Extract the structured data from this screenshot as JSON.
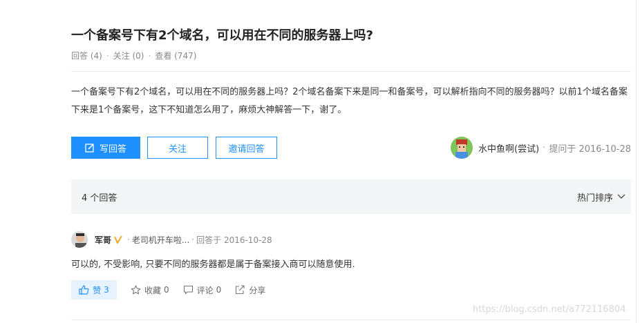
{
  "question": {
    "title": "一个备案号下有2个域名，可以用在不同的服务器上吗?",
    "answers_meta": "回答 (4)",
    "follows_meta": "关注 (0)",
    "views_meta": "查看 (747)",
    "body": "一个备案号下有2个域名，可以用在不同的服务器上吗？2个域名备案下来是同一和备案号，可以解析指向不同的服务器吗？以前1个域名备案下来是1个备案号，这下不知道怎么用了，麻烦大神解答一下，谢了。"
  },
  "buttons": {
    "answer": "写回答",
    "follow": "关注",
    "invite": "邀请回答"
  },
  "asker": {
    "name": "水中鱼啊(尝试)",
    "asked": "提问于 2016-10-28"
  },
  "answers_bar": {
    "count": "4 个回答",
    "sort": "热门排序"
  },
  "answer": {
    "author": "军哥",
    "bio": "老司机开车啦...",
    "answered": "回答于 2016-10-28",
    "text": "可以的, 不受影响, 只要不同的服务器都是属于备案接入商可以随意使用.",
    "like_label": "赞",
    "like_count": "3",
    "collect_label": "收藏",
    "collect_count": "0",
    "comment_label": "评论",
    "comment_count": "0",
    "share_label": "分享"
  },
  "watermark": "https://blog.csdn.net/a772116804",
  "colors": {
    "accent": "#1e90ff",
    "like_bg": "#e6f2fd",
    "bar_bg": "#f4f5f7",
    "verified": "#f5a623"
  },
  "icons": [
    "edit-icon",
    "chevron-down-icon",
    "verified-icon",
    "thumbs-up-icon",
    "star-icon",
    "comment-icon",
    "share-icon"
  ]
}
